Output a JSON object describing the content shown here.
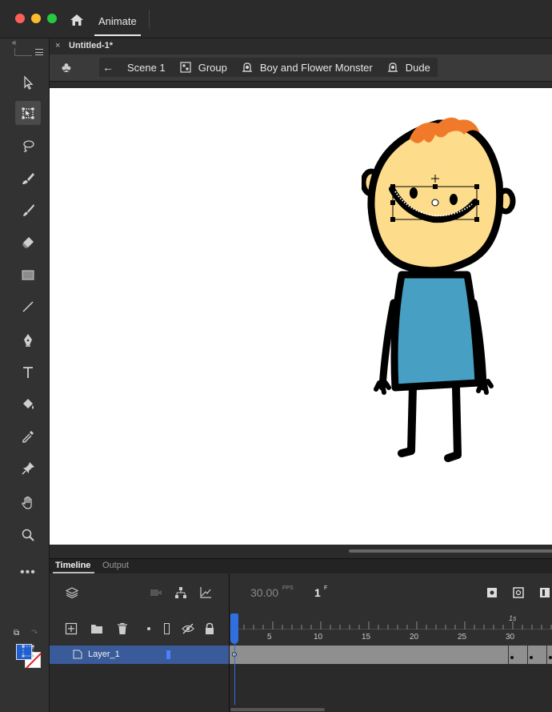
{
  "window": {
    "app_title": "Animate"
  },
  "document": {
    "tab_label": "Untitled-1*",
    "close_glyph": "×"
  },
  "editbar": {
    "crumbs": [
      {
        "label": "Scene 1",
        "icon": "scene-icon"
      },
      {
        "label": "Group",
        "icon": "group-icon"
      },
      {
        "label": "Boy and Flower Monster",
        "icon": "symbol-icon"
      },
      {
        "label": "Dude",
        "icon": "symbol-icon"
      }
    ]
  },
  "tools": [
    {
      "name": "selection-tool",
      "icon": "arrow-icon"
    },
    {
      "name": "free-transform-tool",
      "icon": "transform-icon",
      "active": true
    },
    {
      "name": "lasso-tool",
      "icon": "lasso-icon"
    },
    {
      "name": "brush-tool",
      "icon": "brush-icon"
    },
    {
      "name": "paint-brush-tool",
      "icon": "paintbrush-icon"
    },
    {
      "name": "eraser-tool",
      "icon": "eraser-icon"
    },
    {
      "name": "rectangle-tool",
      "icon": "rectangle-icon"
    },
    {
      "name": "line-tool",
      "icon": "line-icon"
    },
    {
      "name": "pen-tool",
      "icon": "pen-icon"
    },
    {
      "name": "text-tool",
      "icon": "text-icon"
    },
    {
      "name": "paint-bucket-tool",
      "icon": "bucket-icon"
    },
    {
      "name": "eyedropper-tool",
      "icon": "eyedropper-icon"
    },
    {
      "name": "pin-tool",
      "icon": "pin-icon"
    },
    {
      "name": "hand-tool",
      "icon": "hand-icon"
    },
    {
      "name": "zoom-tool",
      "icon": "zoom-icon"
    }
  ],
  "colors": {
    "fill": "#1f5fd6",
    "stroke": "#ffffff",
    "selection": "#2f6fe0"
  },
  "timeline": {
    "tabs": [
      "Timeline",
      "Output"
    ],
    "fps": "30.00",
    "fps_unit": "FPS",
    "frame": "1",
    "frame_unit": "F",
    "seconds_label": "1s",
    "tick_labels": [
      "5",
      "10",
      "15",
      "20",
      "25",
      "30"
    ],
    "layer": {
      "name": "Layer_1"
    }
  }
}
